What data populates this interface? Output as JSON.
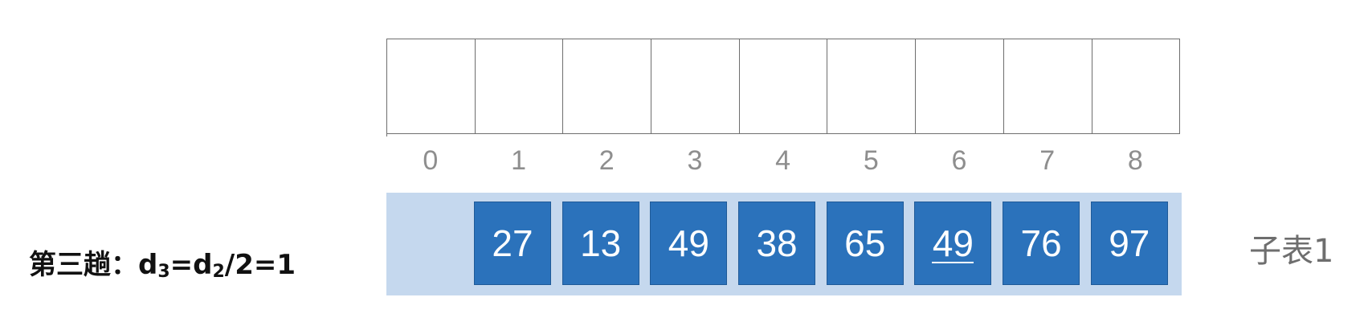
{
  "array": {
    "indices": [
      "0",
      "1",
      "2",
      "3",
      "4",
      "5",
      "6",
      "7",
      "8"
    ]
  },
  "sublist": {
    "name": "子表1",
    "items": [
      {
        "value": "27",
        "underlined": false
      },
      {
        "value": "13",
        "underlined": false
      },
      {
        "value": "49",
        "underlined": false
      },
      {
        "value": "38",
        "underlined": false
      },
      {
        "value": "65",
        "underlined": false
      },
      {
        "value": "49",
        "underlined": true
      },
      {
        "value": "76",
        "underlined": false
      },
      {
        "value": "97",
        "underlined": false
      }
    ]
  },
  "pass": {
    "prefix": "第三趟：d",
    "sub1": "3",
    "mid": "=d",
    "sub2": "2",
    "suffix": "/2=1"
  },
  "colors": {
    "item_fill": "#2b72bb",
    "band_fill": "#c5d8ee",
    "index_text": "#8e8e8e"
  }
}
